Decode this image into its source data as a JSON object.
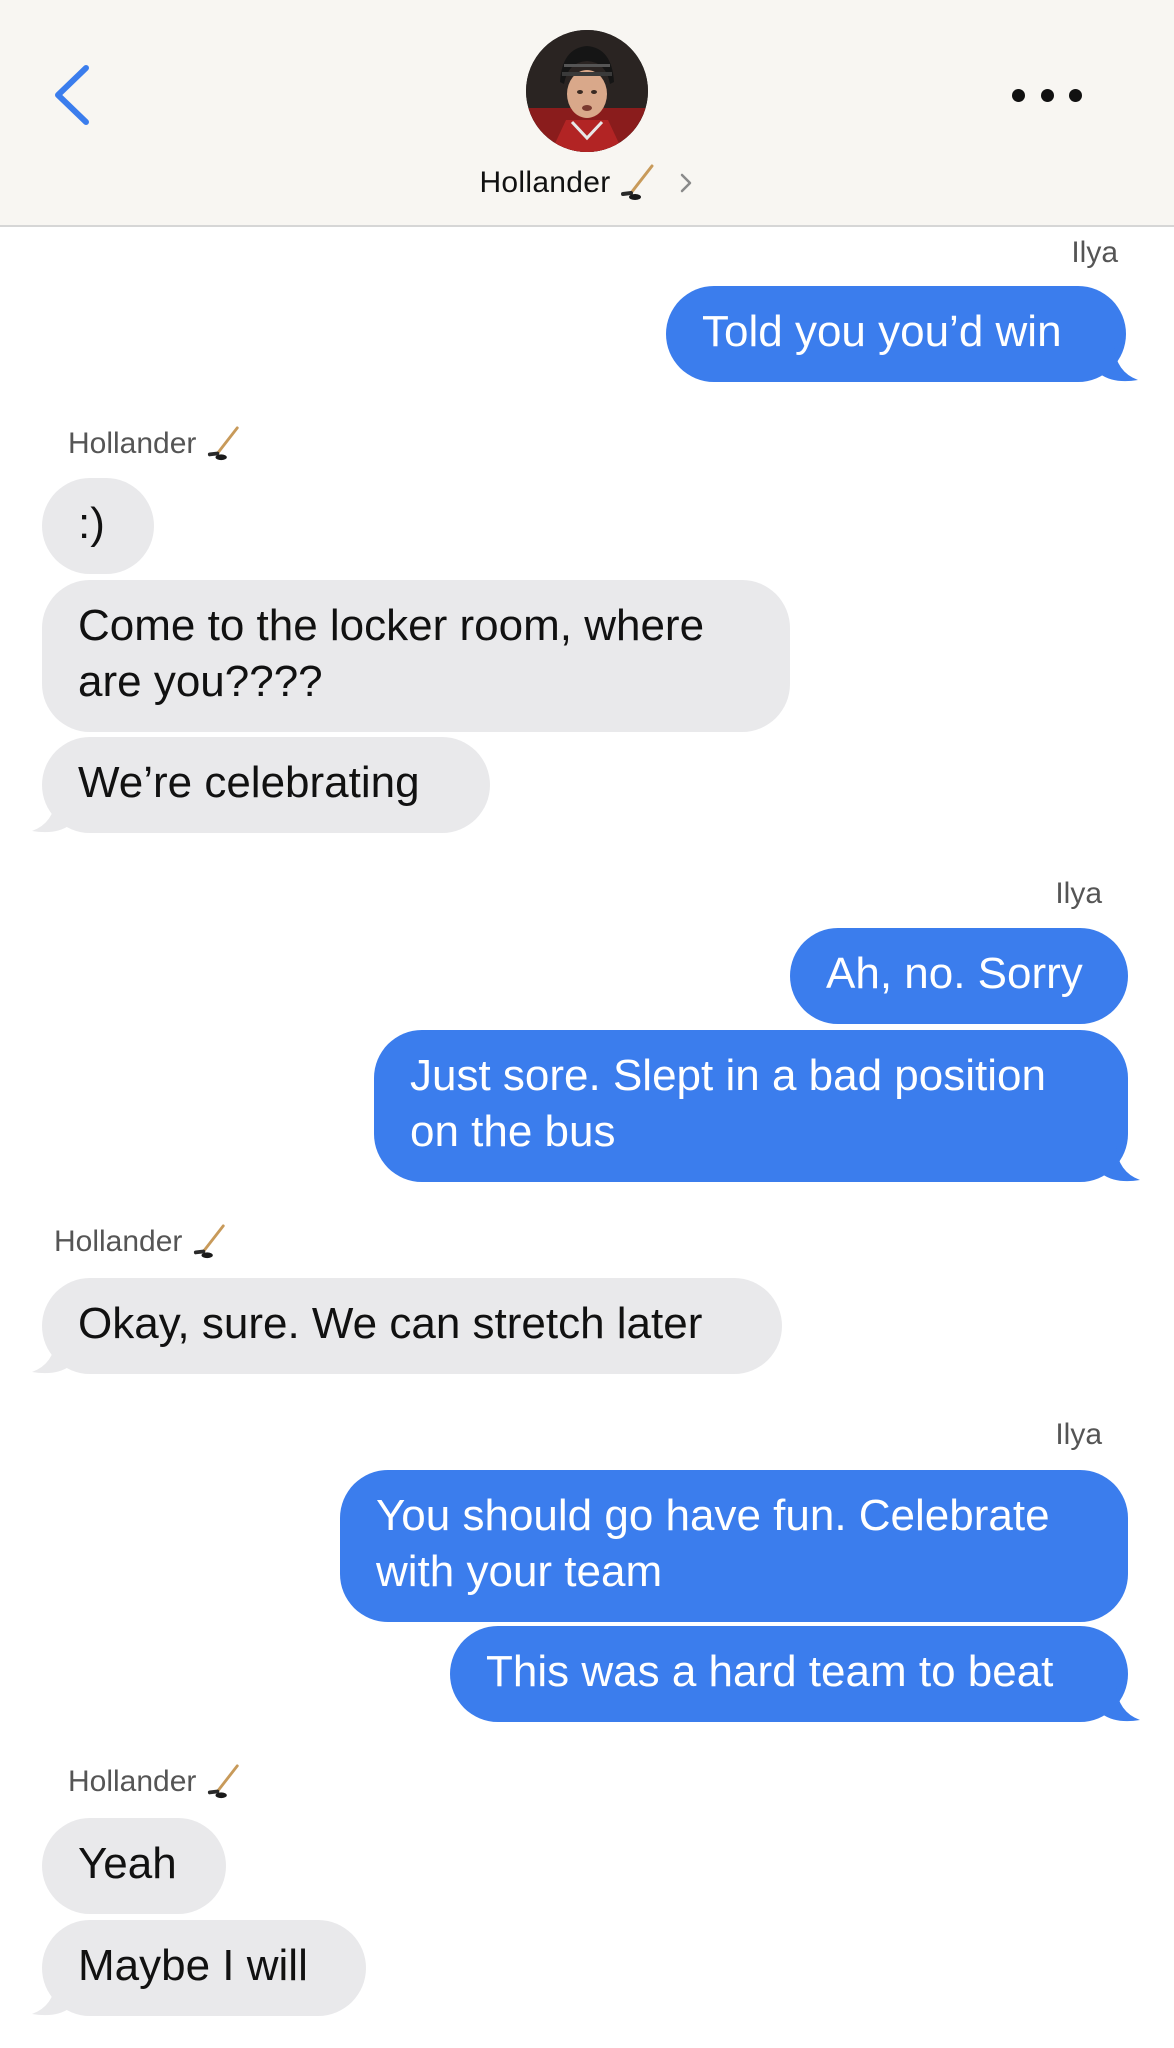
{
  "header": {
    "contact_name": "Hollander"
  },
  "conversation": [
    {
      "sender": "Ilya",
      "direction": "out",
      "messages": [
        "Told you you’d win"
      ]
    },
    {
      "sender": "Hollander",
      "direction": "in",
      "messages": [
        ":)",
        "Come to the locker room, where|are you????",
        "We’re celebrating"
      ]
    },
    {
      "sender": "Ilya",
      "direction": "out",
      "messages": [
        "Ah, no. Sorry",
        "Just sore. Slept in a bad position|on the bus"
      ]
    },
    {
      "sender": "Hollander",
      "direction": "in",
      "messages": [
        "Okay, sure. We can stretch later"
      ]
    },
    {
      "sender": "Ilya",
      "direction": "out",
      "messages": [
        "You should go have fun. Celebrate|with your team",
        "This was a hard team to beat"
      ]
    },
    {
      "sender": "Hollander",
      "direction": "in",
      "messages": [
        "Yeah",
        "Maybe I will"
      ]
    }
  ],
  "colors": {
    "outgoing_bubble": "#3b7ded",
    "incoming_bubble": "#e9e9eb",
    "accent_link": "#3b7ded"
  },
  "icons": {
    "back": "chevron-left-icon",
    "more": "ellipsis-icon",
    "name_emoji": "hockey-stick-icon",
    "disclosure": "chevron-right-icon"
  }
}
